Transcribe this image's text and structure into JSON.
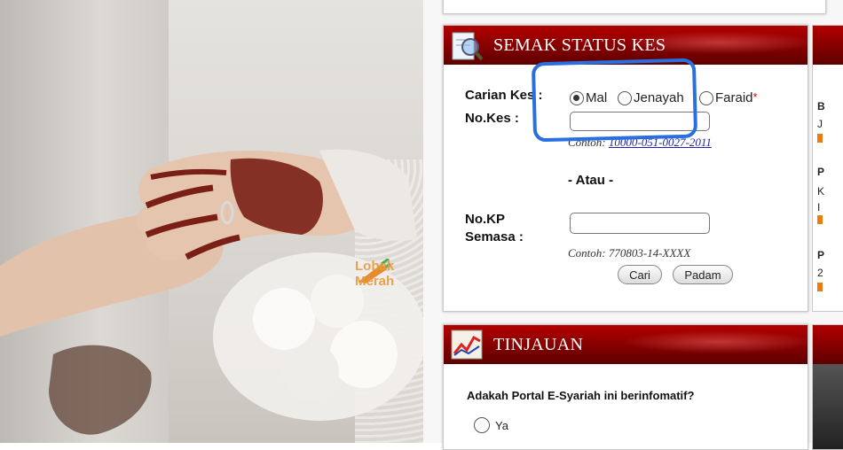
{
  "photo": {
    "alt_subject": "hands with henna and ring",
    "watermark": "Lobak Merah"
  },
  "semak": {
    "title": "SEMAK STATUS KES",
    "carian_label": "Carian Kes :",
    "radios": [
      {
        "label": "Mal",
        "checked": true
      },
      {
        "label": "Jenayah",
        "checked": false
      },
      {
        "label": "Faraid",
        "checked": false
      }
    ],
    "required_mark": "*",
    "nokes_label": "No.Kes :",
    "nokes_value": "",
    "example_prefix": "Contoh:",
    "nokes_example": "10000-051-0027-2011",
    "atau": "- Atau -",
    "nokp_label_1": "No.KP",
    "nokp_label_2": "Semasa :",
    "nokp_value": "",
    "nokp_example": "Contoh: 770803-14-XXXX",
    "cari_button": "Cari",
    "padam_button": "Padam"
  },
  "tinjauan": {
    "title": "TINJAUAN",
    "question": "Adakah Portal E-Syariah ini berinfomatif?",
    "options": [
      {
        "label": "Ya",
        "checked": false
      }
    ]
  },
  "side": {
    "items": [
      "B",
      "J",
      "P",
      "K",
      "I",
      "P",
      "2"
    ]
  },
  "colors": {
    "header_red": "#8c0000",
    "annotation_blue": "#2a6fe0",
    "link_blue": "#2323a8",
    "bullet_orange": "#e87b12",
    "watermark_orange": "#e89a3e"
  }
}
